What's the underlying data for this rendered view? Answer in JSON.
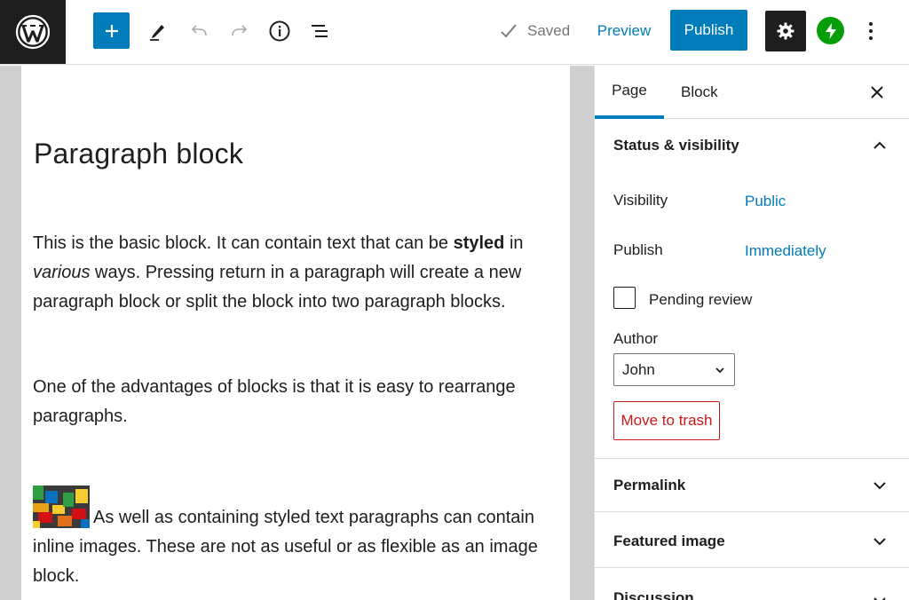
{
  "toolbar": {
    "saved_label": "Saved",
    "preview_label": "Preview",
    "publish_label": "Publish"
  },
  "editor": {
    "title": "Paragraph block",
    "p1_a": "This is the basic block. It can contain text that can be ",
    "p1_bold": "styled",
    "p1_b": " in ",
    "p1_italic": "various",
    "p1_c": " ways. Pressing return in a paragraph will create a new paragraph block or split the block into two paragraph blocks.",
    "p2": "One of the advantages of blocks is that it is easy to rearrange paragraphs.",
    "p3": "As well as containing styled text paragraphs can contain inline images. These are not as useful or as flexible as an image block."
  },
  "sidebar": {
    "tabs": [
      {
        "label": "Page"
      },
      {
        "label": "Block"
      }
    ],
    "status_panel": {
      "title": "Status & visibility",
      "visibility_label": "Visibility",
      "visibility_value": "Public",
      "publish_label": "Publish",
      "publish_value": "Immediately",
      "pending_label": "Pending review",
      "pending_checked": false,
      "author_label": "Author",
      "author_value": "John",
      "trash_label": "Move to trash"
    },
    "panels": [
      {
        "title": "Permalink"
      },
      {
        "title": "Featured image"
      },
      {
        "title": "Discussion"
      }
    ]
  },
  "colors": {
    "accent": "#007cba",
    "dark": "#1e1e1e",
    "danger": "#cc1818",
    "jetpack": "#069e08"
  }
}
